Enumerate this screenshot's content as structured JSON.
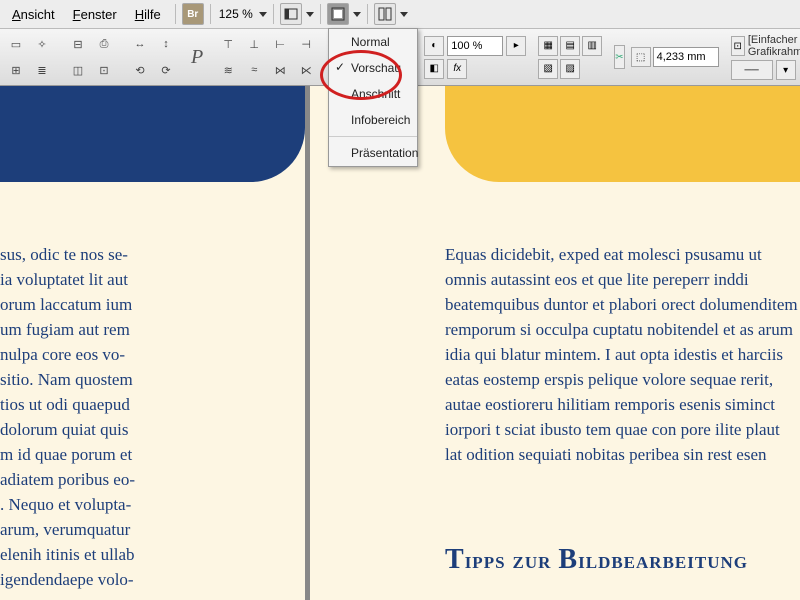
{
  "menu": {
    "ansicht": "Ansicht",
    "fenster": "Fenster",
    "hilfe": "Hilfe",
    "br_label": "Br",
    "zoom": "125 %"
  },
  "toolbar2": {
    "percent_field": "100 %",
    "measure_field": "4,233 mm",
    "graphic_frame_label": "[Einfacher Grafikrahmen]+"
  },
  "view_dropdown": {
    "items": [
      {
        "label": "Normal",
        "checked": false
      },
      {
        "label": "Vorschau",
        "checked": true
      },
      {
        "label": "Anschnitt",
        "checked": false
      },
      {
        "label": "Infobereich",
        "checked": false
      },
      {
        "label": "Präsentation",
        "checked": false
      }
    ]
  },
  "doc": {
    "left_text": "sus, odic te nos se-\nia voluptatet lit aut\norum laccatum ium\num fugiam aut rem\nnulpa core eos vo-\nsitio. Nam quostem\ntios ut odi quaepud\ndolorum quiat quis\nm id quae porum et\nadiatem poribus eo-\n. Nequo et volupta-\narum, verumquatur\nelenih itinis et ullab\nigendendaepe volo-",
    "right_text": "Equas dicidebit, exped eat molesci psusamu ut omnis autassint eos et que lite pereperr inddi beatemquibus duntor et plabori orect dolumenditem remporum si occulpa cuptatu nobitendel et as arum idia qui blatur mintem. I aut opta idestis et harciis eatas eostemp erspis pelique volore sequae rerit, autae eostioreru hilitiam remporis esenis siminct iorpori t sciat ibusto tem quae con pore ilite plaut lat odition sequiati nobitas peribea sin rest esen",
    "heading": "Tipps zur Bildbearbeitung"
  }
}
